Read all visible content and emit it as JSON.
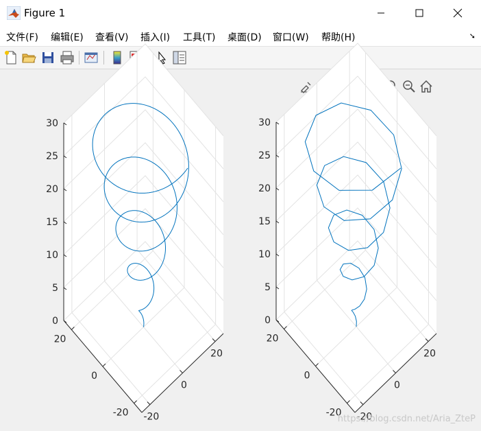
{
  "window": {
    "title": "Figure 1"
  },
  "menu": [
    {
      "id": "file",
      "label": "文件(F)"
    },
    {
      "id": "edit",
      "label": "编辑(E)"
    },
    {
      "id": "view",
      "label": "查看(V)"
    },
    {
      "id": "insert",
      "label": "插入(I)"
    },
    {
      "id": "tools",
      "label": "工具(T)"
    },
    {
      "id": "desktop",
      "label": "桌面(D)"
    },
    {
      "id": "window",
      "label": "窗口(W)"
    },
    {
      "id": "help",
      "label": "帮助(H)"
    }
  ],
  "toolbar": [
    {
      "icon": "new-figure-icon"
    },
    {
      "icon": "open-file-icon"
    },
    {
      "icon": "save-icon"
    },
    {
      "icon": "print-icon"
    },
    {
      "icon": "link-plot-icon"
    },
    {
      "icon": "colorbar-icon"
    },
    {
      "icon": "legend-icon"
    },
    {
      "icon": "pointer-icon"
    },
    {
      "icon": "property-inspector-icon"
    }
  ],
  "axes_toolbar": [
    {
      "icon": "brush-icon"
    },
    {
      "icon": "data-tips-icon"
    },
    {
      "icon": "rotate-3d-icon"
    },
    {
      "icon": "pan-icon"
    },
    {
      "icon": "zoom-in-icon"
    },
    {
      "icon": "zoom-out-icon"
    },
    {
      "icon": "home-icon"
    }
  ],
  "colors": {
    "line": "#0072bd",
    "grid": "#e3e3e3",
    "axis": "#262626",
    "bg": "#f0f0f0"
  },
  "chart_data": [
    {
      "type": "line",
      "description": "3D spiral, smooth",
      "z_ticks": [
        "0",
        "5",
        "10",
        "15",
        "20",
        "25",
        "30"
      ],
      "x_ticks": [
        "-20",
        "0",
        "20"
      ],
      "y_ticks": [
        "-20",
        "0",
        "20"
      ],
      "zlim": [
        0,
        30
      ],
      "series": [
        {
          "t_range": [
            0,
            30
          ],
          "samples": 800
        }
      ]
    },
    {
      "type": "line",
      "description": "3D spiral, coarse segments",
      "z_ticks": [
        "0",
        "5",
        "10",
        "15",
        "20",
        "25",
        "30"
      ],
      "x_ticks": [
        "-20",
        "0",
        "20"
      ],
      "y_ticks": [
        "-20",
        "0",
        "20"
      ],
      "zlim": [
        0,
        30
      ],
      "series": [
        {
          "t_range": [
            0,
            30
          ],
          "samples": 48
        }
      ]
    }
  ],
  "watermark": "https://blog.csdn.net/Aria_ZteP"
}
